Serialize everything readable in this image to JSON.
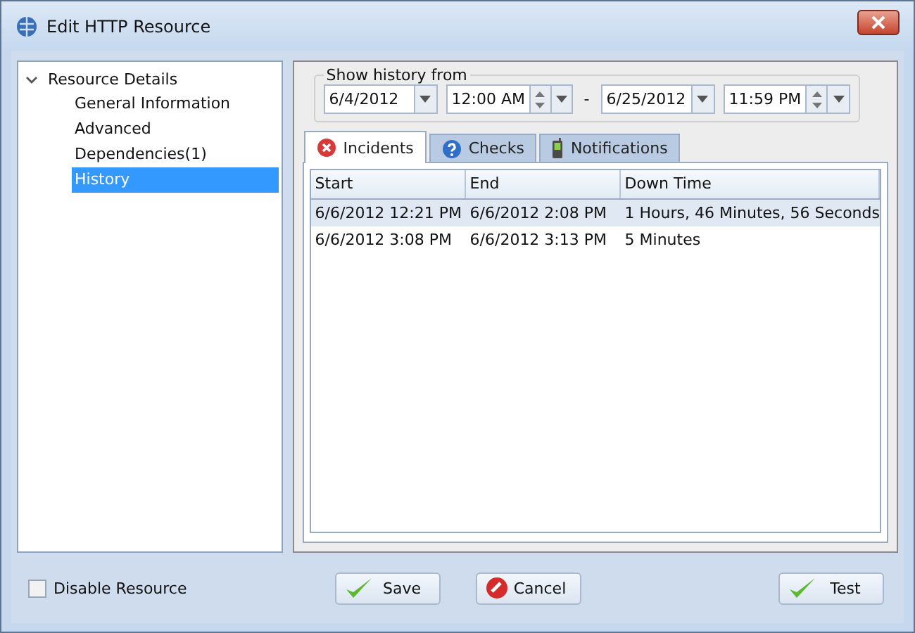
{
  "window": {
    "title": "Edit HTTP Resource"
  },
  "tree": {
    "label": "Resource Details",
    "expanded": true,
    "children": [
      {
        "label": "General Information",
        "selected": false
      },
      {
        "label": "Advanced",
        "selected": false
      },
      {
        "label": "Dependencies(1)",
        "selected": false
      },
      {
        "label": "History",
        "selected": true
      }
    ]
  },
  "history": {
    "legend": "Show history from",
    "from_date": "6/4/2012",
    "from_time": "12:00 AM",
    "separator": "-",
    "to_date": "6/25/2012",
    "to_time": "11:59 PM"
  },
  "tabs": [
    {
      "label": "Incidents",
      "kind": "error",
      "selected": true
    },
    {
      "label": "Checks",
      "kind": "help",
      "selected": false
    },
    {
      "label": "Notifications",
      "kind": "phone",
      "selected": false
    }
  ],
  "table": {
    "columns": [
      "Start",
      "End",
      "Down Time"
    ],
    "rows": [
      {
        "cells": [
          "6/6/2012 12:21 PM",
          "6/6/2012 2:08 PM",
          "1 Hours, 46 Minutes, 56 Seconds"
        ],
        "selected": true
      },
      {
        "cells": [
          "6/6/2012 3:08 PM",
          "6/6/2012 3:13 PM",
          "5 Minutes"
        ],
        "selected": false
      }
    ]
  },
  "disable": {
    "label": "Disable Resource",
    "checked": false
  },
  "buttons": [
    {
      "label": "Save",
      "kind": "ok"
    },
    {
      "label": "Cancel",
      "kind": "cancel"
    },
    {
      "label": "Test",
      "kind": "ok"
    }
  ]
}
